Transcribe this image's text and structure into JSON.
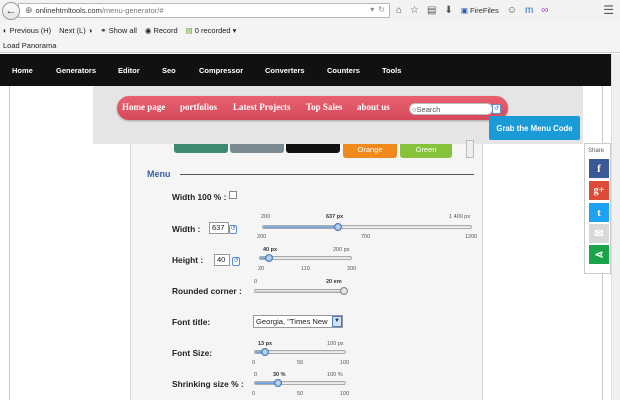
{
  "browser": {
    "url_host": "onlinehtmltools.com",
    "url_path": "/menu-generator/#",
    "firefiles_label": "FireFiles",
    "findbar": {
      "previous": "Previous",
      "previous_key": "(H)",
      "next": "Next",
      "next_key": "(L)",
      "show_all": "Show all",
      "record": "Record",
      "recorded": "0 recorded"
    },
    "bookmark": "Load Panorama"
  },
  "site_nav": [
    "Home",
    "Generators",
    "Editor",
    "Seo",
    "Compressor",
    "Converters",
    "Counters",
    "Tools"
  ],
  "demo_menu": {
    "items": [
      "Home page",
      "portfolios",
      "Latest Projects",
      "Top Sales",
      "about us"
    ],
    "search_placeholder": "Search",
    "grab_button": "Grab the Menu Code",
    "background_color": "#e05566"
  },
  "color_swatches": [
    {
      "label": "",
      "color": "#3e8a6e"
    },
    {
      "label": "",
      "color": "#7b8a92"
    },
    {
      "label": "",
      "color": "#111111"
    },
    {
      "label": "Orange",
      "color": "#f08a1c"
    },
    {
      "label": "Green",
      "color": "#86c23a"
    }
  ],
  "menu_section": {
    "title": "Menu",
    "width_100": {
      "label": "Width 100 % :",
      "checked": false
    },
    "width": {
      "label": "Width :",
      "value": "637",
      "slider_value": "637 px",
      "top_min": "200",
      "top_max": "1 400 px",
      "bottom_ticks": [
        "200",
        "700",
        "1200"
      ]
    },
    "height": {
      "label": "Height :",
      "value": "40",
      "slider_value": "40 px",
      "top_max": "200 px",
      "bottom_ticks": [
        "20",
        "110",
        "200"
      ]
    },
    "rounded_corner": {
      "label": "Rounded corner :",
      "min": "0",
      "slider_value": "20 em"
    },
    "font_title": {
      "label": "Font title:",
      "value": "Georgia, \"Times New"
    },
    "font_size": {
      "label": "Font Size:",
      "slider_value": "13 px",
      "top_max": "100 px",
      "bottom_ticks": [
        "0",
        "50",
        "100"
      ]
    },
    "shrinking_size": {
      "label": "Shrinking size % :",
      "min": "0",
      "slider_value": "30 %",
      "top_max": "100 %",
      "bottom_ticks": [
        "0",
        "50",
        "100"
      ]
    }
  },
  "share": {
    "label": "Share",
    "buttons": [
      {
        "name": "facebook",
        "glyph": "f",
        "color": "#3b5998"
      },
      {
        "name": "google-plus",
        "glyph": "g+",
        "color": "#dd4b39"
      },
      {
        "name": "twitter",
        "glyph": "t",
        "color": "#1da1f2"
      },
      {
        "name": "email",
        "glyph": "✉",
        "color": "#cccccc"
      },
      {
        "name": "share-more",
        "glyph": "<",
        "color": "#1aa34a"
      }
    ]
  }
}
